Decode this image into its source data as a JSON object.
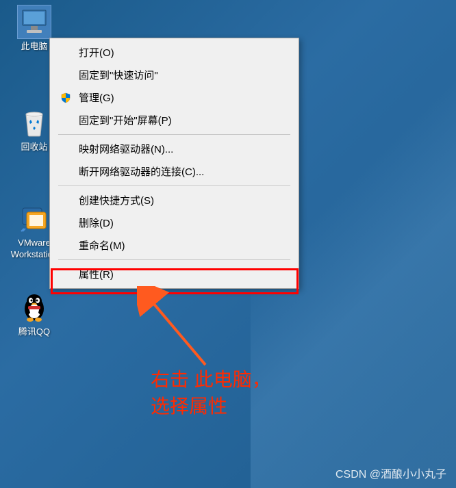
{
  "desktop": {
    "icons": [
      {
        "id": "this-pc",
        "label": "此电脑"
      },
      {
        "id": "recycle-bin",
        "label": "回收站"
      },
      {
        "id": "vmware",
        "label": "VMware Workstation"
      },
      {
        "id": "tencent-qq",
        "label": "腾讯QQ"
      }
    ]
  },
  "context_menu": {
    "items": [
      {
        "label": "打开(O)"
      },
      {
        "label": "固定到\"快速访问\""
      },
      {
        "label": "管理(G)",
        "icon": "shield-icon"
      },
      {
        "label": "固定到\"开始\"屏幕(P)"
      },
      {
        "sep": true
      },
      {
        "label": "映射网络驱动器(N)..."
      },
      {
        "label": "断开网络驱动器的连接(C)..."
      },
      {
        "sep": true
      },
      {
        "label": "创建快捷方式(S)"
      },
      {
        "label": "删除(D)"
      },
      {
        "label": "重命名(M)"
      },
      {
        "sep": true
      },
      {
        "label": "属性(R)"
      }
    ]
  },
  "annotation": {
    "line1": "右击 此电脑，",
    "line2": "选择属性"
  },
  "watermark": "CSDN @酒酿小小丸子",
  "highlight_target": "属性(R)"
}
